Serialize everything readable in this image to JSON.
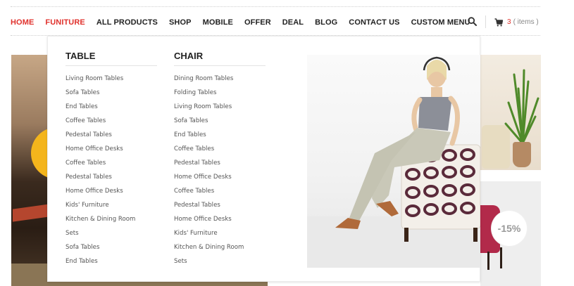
{
  "nav": {
    "items": [
      {
        "label": "HOME",
        "active": true
      },
      {
        "label": "FUNITURE",
        "active": true
      },
      {
        "label": "ALL PRODUCTS",
        "active": false
      },
      {
        "label": "SHOP",
        "active": false
      },
      {
        "label": "MOBILE",
        "active": false
      },
      {
        "label": "OFFER",
        "active": false
      },
      {
        "label": "DEAL",
        "active": false
      },
      {
        "label": "BLOG",
        "active": false
      },
      {
        "label": "CONTACT US",
        "active": false
      },
      {
        "label": "CUSTOM MENU",
        "active": false
      }
    ],
    "search_icon": "search-icon",
    "cart": {
      "icon": "cart-icon",
      "count": "3",
      "label": "( items )"
    }
  },
  "mega_menu": {
    "table": {
      "title": "TABLE",
      "items": [
        "Living Room Tables",
        "Sofa Tables",
        "End Tables",
        "Coffee Tables",
        "Pedestal Tables",
        "Home Office Desks",
        "Coffee Tables",
        "Pedestal Tables",
        "Home Office Desks",
        "Kids' Furniture",
        "Kitchen & Dining Room",
        "Sets",
        "Sofa Tables",
        "End Tables"
      ]
    },
    "chair": {
      "title": "CHAIR",
      "items": [
        "Dining Room Tables",
        "Folding Tables",
        "Living Room Tables",
        "Sofa Tables",
        "End Tables",
        "Coffee Tables",
        "Pedestal Tables",
        "Home Office Desks",
        "Coffee Tables",
        "Pedestal Tables",
        "Home Office Desks",
        "Kids' Furniture",
        "Kitchen & Dining Room",
        "Sets"
      ]
    }
  },
  "promo_badge": "-15%",
  "colors": {
    "accent": "#e0322d",
    "text": "#222222",
    "submenu_text": "#555555",
    "slider_circle": "#f4b51c"
  }
}
